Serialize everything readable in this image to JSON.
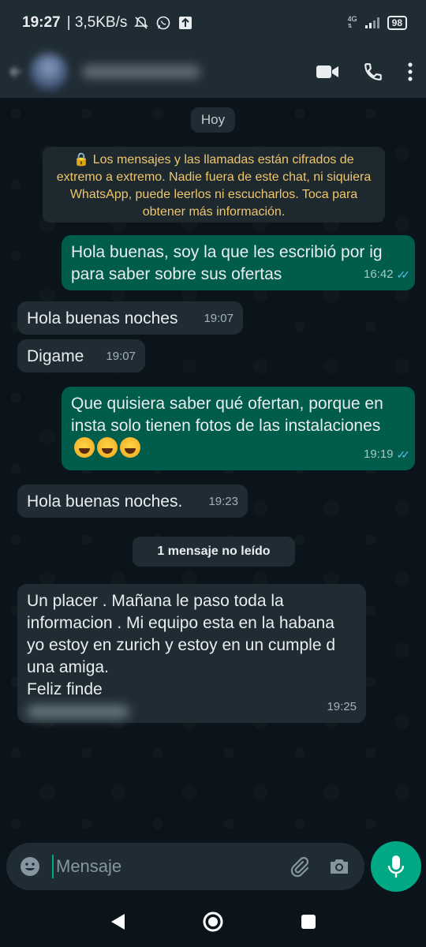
{
  "status_bar": {
    "time": "19:27",
    "speed": "| 3,5KB/s",
    "network": "4G",
    "battery": "98"
  },
  "header": {
    "contact_name": "",
    "icons": [
      "back-arrow-icon",
      "video-call-icon",
      "voice-call-icon",
      "more-options-icon"
    ]
  },
  "chat": {
    "date_chip": "Hoy",
    "encryption_notice": "🔒 Los mensajes y las llamadas están cifrados de extremo a extremo. Nadie fuera de este chat, ni siquiera WhatsApp, puede leerlos ni escucharlos. Toca para obtener más información.",
    "messages": [
      {
        "direction": "out",
        "text": "Hola buenas, soy la que les escribió por ig para saber sobre sus ofertas",
        "time": "16:42",
        "status": "read"
      },
      {
        "direction": "in",
        "text": "Hola buenas noches",
        "time": "19:07"
      },
      {
        "direction": "in",
        "text": "Digame",
        "time": "19:07"
      },
      {
        "direction": "out",
        "text": "Que quisiera saber qué ofertan, porque en insta solo tienen fotos de las instalaciones",
        "emoji": "😅😅😅",
        "time": "19:19",
        "status": "read"
      },
      {
        "direction": "in",
        "text": "Hola buenas noches.",
        "time": "19:23"
      },
      {
        "direction": "in",
        "text": "Un placer . Mañana le paso toda la informacion . Mi equipo esta en la habana yo estoy en zurich y estoy en un cumple d una amiga.",
        "text2": "Feliz finde",
        "time": "19:25"
      }
    ],
    "unread_chip": "1 mensaje no leído"
  },
  "input": {
    "placeholder": "Mensaje"
  },
  "colors": {
    "accent": "#00a884",
    "outgoing_bubble": "#005c4b",
    "incoming_bubble": "#1f2c34",
    "read_ticks": "#53bdeb",
    "encryption_text": "#f0c66b"
  }
}
